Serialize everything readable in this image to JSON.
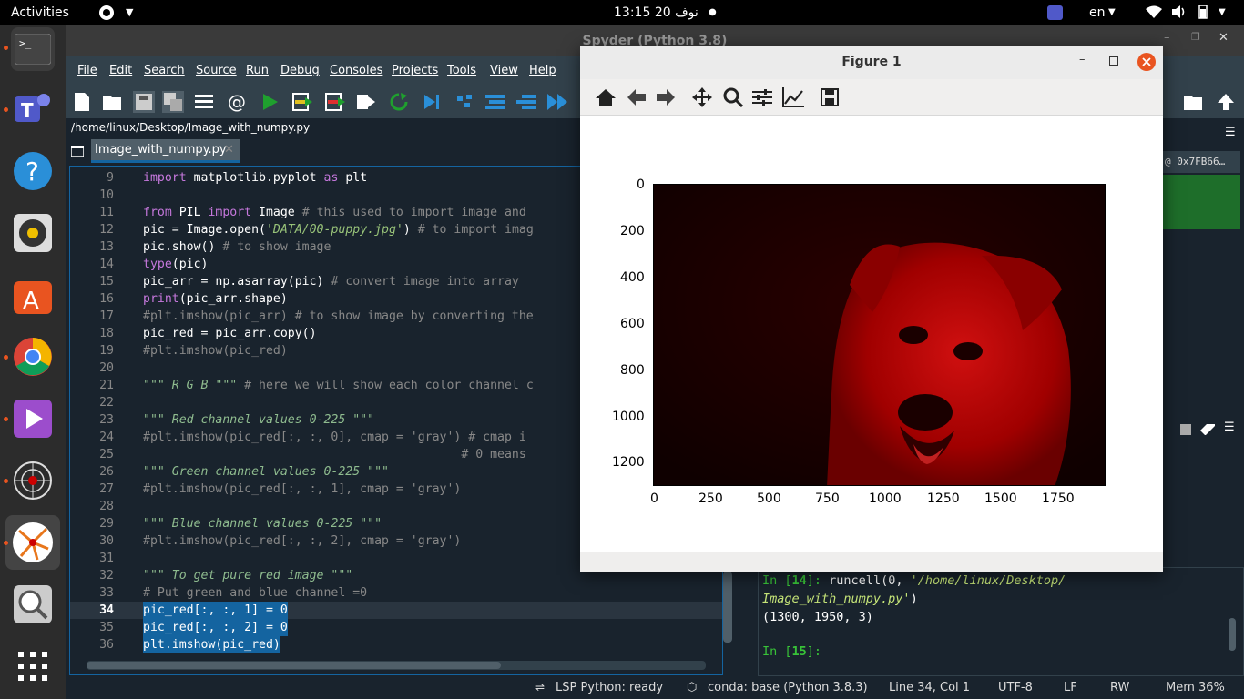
{
  "topbar": {
    "activities": "Activities",
    "clock": "نوف 20  13:15",
    "lang": "en"
  },
  "dock": {
    "items": [
      "terminal-icon",
      "teams-icon",
      "help-icon",
      "rhythmbox-icon",
      "software-icon",
      "chrome-icon",
      "media-icon",
      "spider-icon",
      "spyder-icon",
      "magnifier-icon",
      "apps-grid-icon"
    ]
  },
  "spyder": {
    "title": "Spyder (Python 3.8)",
    "menu": [
      "File",
      "Edit",
      "Search",
      "Source",
      "Run",
      "Debug",
      "Consoles",
      "Projects",
      "Tools",
      "View",
      "Help"
    ],
    "path": "/home/linux/Desktop/Image_with_numpy.py",
    "tab": "Image_with_numpy.py",
    "right_label": "@ 0x7FB66…",
    "editor": {
      "lines": [
        {
          "n": "9",
          "t": "import matplotlib.pyplot as plt"
        },
        {
          "n": "10",
          "t": ""
        },
        {
          "n": "11",
          "t": "from PIL import Image # this used to import image and"
        },
        {
          "n": "12",
          "t": "pic = Image.open('DATA/00-puppy.jpg') # to import imag"
        },
        {
          "n": "13",
          "t": "pic.show() # to show image"
        },
        {
          "n": "14",
          "t": "type(pic)"
        },
        {
          "n": "15",
          "t": "pic_arr = np.asarray(pic) # convert image into array"
        },
        {
          "n": "16",
          "t": "print(pic_arr.shape)"
        },
        {
          "n": "17",
          "t": "#plt.imshow(pic_arr) # to show image by converting the"
        },
        {
          "n": "18",
          "t": "pic_red = pic_arr.copy()"
        },
        {
          "n": "19",
          "t": "#plt.imshow(pic_red)"
        },
        {
          "n": "20",
          "t": ""
        },
        {
          "n": "21",
          "t": "\"\"\" R G B \"\"\" # here we will show each color channel c"
        },
        {
          "n": "22",
          "t": ""
        },
        {
          "n": "23",
          "t": "\"\"\" Red channel values 0-225 \"\"\""
        },
        {
          "n": "24",
          "t": "#plt.imshow(pic_red[:, :, 0], cmap = 'gray') # cmap i"
        },
        {
          "n": "25",
          "t": "                                            # 0 means"
        },
        {
          "n": "26",
          "t": "\"\"\" Green channel values 0-225 \"\"\""
        },
        {
          "n": "27",
          "t": "#plt.imshow(pic_red[:, :, 1], cmap = 'gray')"
        },
        {
          "n": "28",
          "t": ""
        },
        {
          "n": "29",
          "t": "\"\"\" Blue channel values 0-225 \"\"\""
        },
        {
          "n": "30",
          "t": "#plt.imshow(pic_red[:, :, 2], cmap = 'gray')"
        },
        {
          "n": "31",
          "t": ""
        },
        {
          "n": "32",
          "t": "\"\"\" To get pure red image \"\"\""
        },
        {
          "n": "33",
          "t": "# Put green and blue channel =0"
        },
        {
          "n": "34",
          "t": "pic_red[:, :, 1] = 0"
        },
        {
          "n": "35",
          "t": "pic_red[:, :, 2] = 0"
        },
        {
          "n": "36",
          "t": "plt.imshow(pic_red)"
        }
      ]
    },
    "console": {
      "in14": "In [",
      "in14n": "14",
      "in14c": "]: ",
      "cmd1": "runcell(0, ",
      "cmd1s": "'/home/linux/Desktop/",
      "cmd2s": "Image_with_numpy.py'",
      "cmd2e": ")",
      "out": "(1300, 1950, 3)",
      "in15": "In [",
      "in15n": "15",
      "in15c": "]:"
    },
    "status": {
      "lsp": "LSP Python: ready",
      "conda": "conda: base (Python 3.8.3)",
      "pos": "Line 34, Col 1",
      "enc": "UTF-8",
      "eol": "LF",
      "rw": "RW",
      "mem": "Mem 36%"
    }
  },
  "figure": {
    "title": "Figure 1",
    "toolbar": [
      "home-icon",
      "back-icon",
      "forward-icon",
      "pan-icon",
      "zoom-icon",
      "configure-icon",
      "edit-curves-icon",
      "save-icon"
    ],
    "yticks": [
      "0",
      "200",
      "400",
      "600",
      "800",
      "1000",
      "1200"
    ],
    "xticks": [
      "0",
      "250",
      "500",
      "750",
      "1000",
      "1250",
      "1500",
      "1750"
    ]
  },
  "colors": {
    "accent": "#1464a0",
    "red_image": "#b00000",
    "close": "#e95420"
  }
}
